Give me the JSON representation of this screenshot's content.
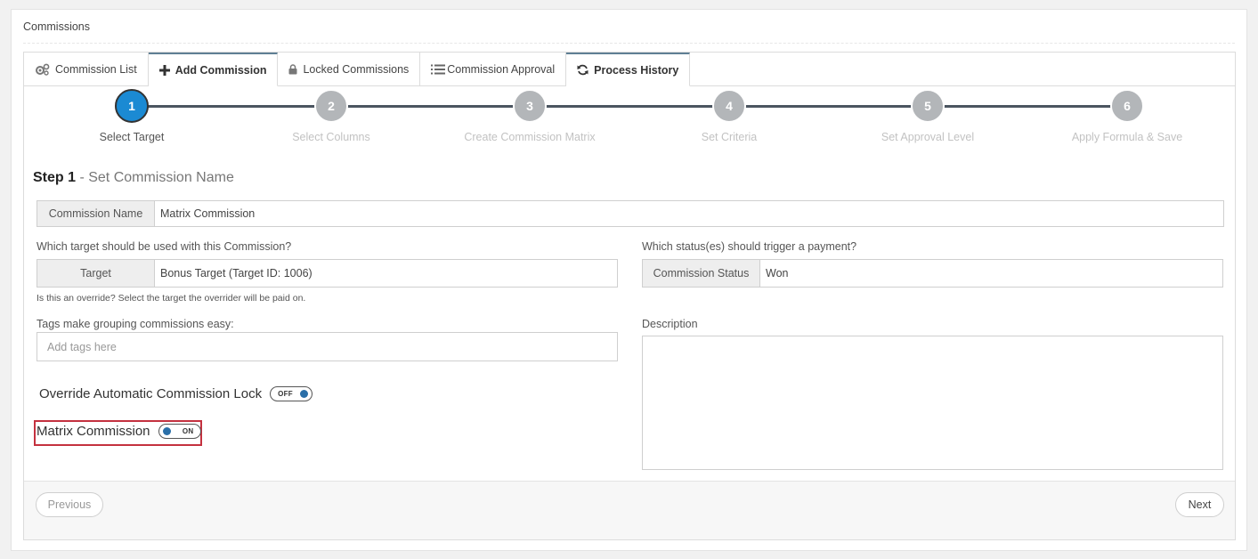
{
  "page": {
    "title": "Commissions"
  },
  "tabs": [
    {
      "label": "Commission List",
      "icon": "gears-icon"
    },
    {
      "label": "Add Commission",
      "icon": "plus-icon"
    },
    {
      "label": "Locked Commissions",
      "icon": "lock-icon"
    },
    {
      "label": "Commission Approval",
      "icon": "list-icon"
    },
    {
      "label": "Process History",
      "icon": "refresh-icon"
    }
  ],
  "wizard": {
    "steps": [
      {
        "number": "1",
        "label": "Select Target"
      },
      {
        "number": "2",
        "label": "Select Columns"
      },
      {
        "number": "3",
        "label": "Create Commission Matrix"
      },
      {
        "number": "4",
        "label": "Set Criteria"
      },
      {
        "number": "5",
        "label": "Set Approval Level"
      },
      {
        "number": "6",
        "label": "Apply Formula & Save"
      }
    ],
    "active_step": 1
  },
  "step_heading": {
    "step": "Step 1",
    "title": " - Set Commission Name"
  },
  "form": {
    "commission_name": {
      "label": "Commission Name",
      "value": "Matrix Commission"
    },
    "target_question": "Which target should be used with this Commission?",
    "target": {
      "label": "Target",
      "value": "Bonus Target (Target ID: 1006)"
    },
    "override_hint": "Is this an override?  Select the target the overrider will be paid on.",
    "status_question": "Which status(es) should trigger a payment?",
    "commission_status": {
      "label": "Commission Status",
      "value": "Won"
    },
    "tags_label": "Tags make grouping commissions easy:",
    "tags_placeholder": "Add tags here",
    "description_label": "Description",
    "override_lock": {
      "label": "Override Automatic Commission Lock",
      "state": "OFF"
    },
    "matrix_commission": {
      "label": "Matrix Commission",
      "state": "ON"
    }
  },
  "footer": {
    "previous": "Previous",
    "next": "Next"
  },
  "colors": {
    "accent": "#1b8ad3",
    "toggle_knob": "#2a6fa8",
    "highlight": "#c4313f"
  }
}
